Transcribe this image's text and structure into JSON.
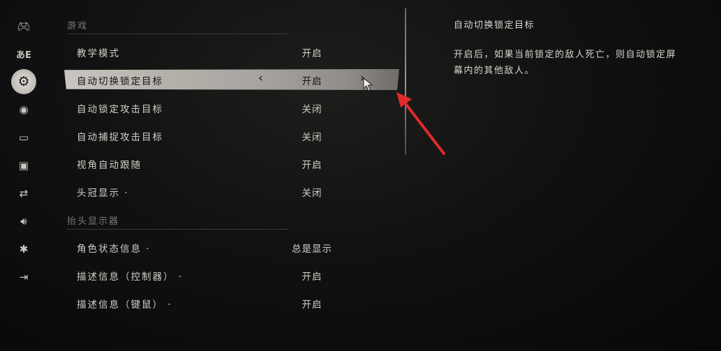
{
  "sidebar": {
    "icons": [
      {
        "name": "gamepad-icon",
        "glyph": "🎮︎"
      },
      {
        "name": "language-icon",
        "glyph": "あE"
      },
      {
        "name": "gear-icon",
        "glyph": "⚙",
        "active": true
      },
      {
        "name": "eye-icon",
        "glyph": "◉"
      },
      {
        "name": "chat-icon",
        "glyph": "▭"
      },
      {
        "name": "monitor-icon",
        "glyph": "▣"
      },
      {
        "name": "swap-arrows-icon",
        "glyph": "⇄"
      },
      {
        "name": "speaker-icon",
        "glyph": "🔊︎"
      },
      {
        "name": "accessibility-icon",
        "glyph": "✱"
      },
      {
        "name": "exit-icon",
        "glyph": "⇥"
      }
    ]
  },
  "sections": {
    "game": "游戏",
    "hud": "抬头显示器"
  },
  "rows": {
    "tutorial": {
      "label": "教学模式",
      "value": "开启"
    },
    "auto_switch_target": {
      "label": "自动切换锁定目标",
      "value": "开启"
    },
    "auto_lock_target": {
      "label": "自动锁定攻击目标",
      "value": "关闭"
    },
    "auto_capture_target": {
      "label": "自动捕捉攻击目标",
      "value": "关闭"
    },
    "camera_follow": {
      "label": "视角自动跟随",
      "value": "开启"
    },
    "helmet_display": {
      "label": "头冠显示 ·",
      "value": "关闭"
    },
    "status_info": {
      "label": "角色状态信息 ·",
      "value": "总是显示"
    },
    "desc_controller": {
      "label": "描述信息（控制器） ·",
      "value": "开启"
    },
    "desc_mouse": {
      "label": "描述信息（键鼠） ·",
      "value": "开启"
    }
  },
  "selector": {
    "left_arrow": "‹",
    "right_arrow": "›"
  },
  "description": {
    "title": "自动切换锁定目标",
    "text": "开启后，如果当前锁定的敌人死亡，则自动锁定屏幕内的其他敌人。"
  },
  "colors": {
    "annotation": "#e02a2a",
    "highlight": "#b8b5af"
  }
}
